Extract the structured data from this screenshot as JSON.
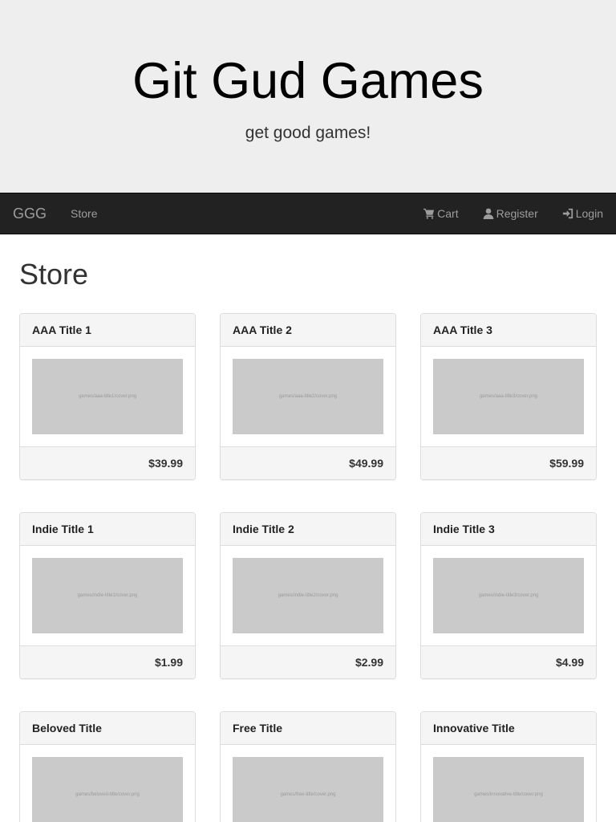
{
  "header": {
    "title": "Git Gud Games",
    "tagline": "get good games!"
  },
  "navbar": {
    "brand": "GGG",
    "store": "Store",
    "cart": "Cart",
    "register": "Register",
    "login": "Login",
    "icons": {
      "cart": "shopping-cart-icon",
      "register": "user-icon",
      "login": "login-icon"
    }
  },
  "page": {
    "title": "Store"
  },
  "games": [
    {
      "title": "AAA Title 1",
      "image_alt": "games/aaa-title1/cover.png",
      "price": "$39.99"
    },
    {
      "title": "AAA Title 2",
      "image_alt": "games/aaa-title2/cover.png",
      "price": "$49.99"
    },
    {
      "title": "AAA Title 3",
      "image_alt": "games/aaa-title3/cover.png",
      "price": "$59.99"
    },
    {
      "title": "Indie Title 1",
      "image_alt": "games/indie-title1/cover.png",
      "price": "$1.99"
    },
    {
      "title": "Indie Title 2",
      "image_alt": "games/indie-title2/cover.png",
      "price": "$2.99"
    },
    {
      "title": "Indie Title 3",
      "image_alt": "games/indie-title3/cover.png",
      "price": "$4.99"
    },
    {
      "title": "Beloved Title",
      "image_alt": "games/beloved-title/cover.png"
    },
    {
      "title": "Free Title",
      "image_alt": "games/free-title/cover.png"
    },
    {
      "title": "Innovative Title",
      "image_alt": "games/innovative-title/cover.png"
    }
  ],
  "colors": {
    "jumbotron_bg": "#eeeeee",
    "navbar_bg": "#222222",
    "navbar_text": "#9d9d9d",
    "card_header_bg": "#f5f5f5",
    "image_placeholder": "#cacaca"
  }
}
